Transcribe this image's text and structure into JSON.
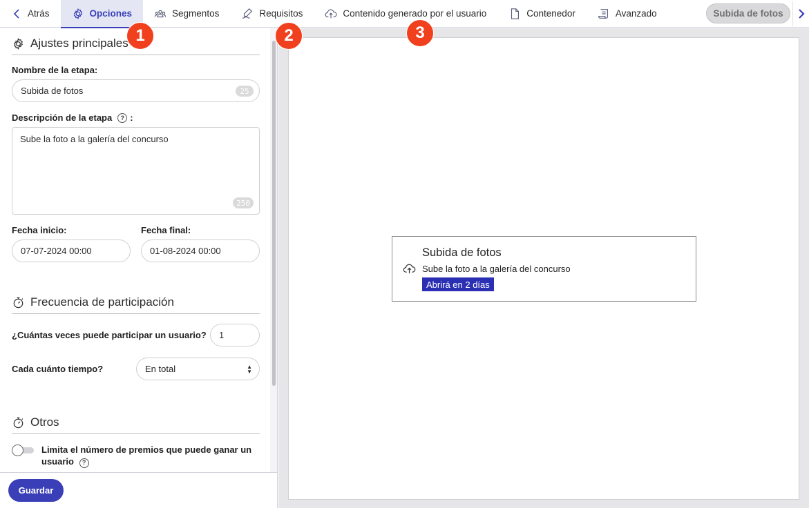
{
  "nav": {
    "back_label": "Atrás",
    "tabs": [
      {
        "label": "Opciones",
        "icon": "gear-icon",
        "active": true
      },
      {
        "label": "Segmentos",
        "icon": "users-group-icon",
        "active": false
      },
      {
        "label": "Requisitos",
        "icon": "signature-icon",
        "active": false
      },
      {
        "label": "Contenido generado por el usuario",
        "icon": "cloud-upload-icon",
        "active": false
      },
      {
        "label": "Contenedor",
        "icon": "document-icon",
        "active": false
      },
      {
        "label": "Avanzado",
        "icon": "scroll-icon",
        "active": false
      }
    ],
    "stage_pill": "Subida de fotos"
  },
  "markers": [
    "1",
    "2",
    "3"
  ],
  "form": {
    "main_settings_title": "Ajustes principales",
    "stage_name_label": "Nombre de la etapa:",
    "stage_name_value": "Subida de fotos",
    "stage_name_counter": "25",
    "stage_description_label": "Descripción de la etapa",
    "stage_description_label_suffix": ":",
    "stage_description_value": "Sube la foto a la galería del concurso",
    "stage_description_counter": "250",
    "start_date_label": "Fecha inicio:",
    "start_date_value": "07-07-2024 00:00",
    "end_date_label": "Fecha final:",
    "end_date_value": "01-08-2024 00:00",
    "frequency_title": "Frecuencia de participación",
    "times_label": "¿Cuántas veces puede participar un usuario?",
    "times_value": "1",
    "period_label": "Cada cuánto tiempo?",
    "period_value": "En total",
    "others_title": "Otros",
    "limit_prizes_label": "Limita el número de premios que puede ganar un usuario",
    "limit_prizes_enabled": false,
    "save_label": "Guardar"
  },
  "preview": {
    "card_title": "Subida de fotos",
    "card_description": "Sube la foto a la galería del concurso",
    "card_badge": "Abrirá en 2 días",
    "badge_color": "#2b2fb3"
  },
  "colors": {
    "accent": "#3a3fb8",
    "marker": "#f0401e"
  }
}
